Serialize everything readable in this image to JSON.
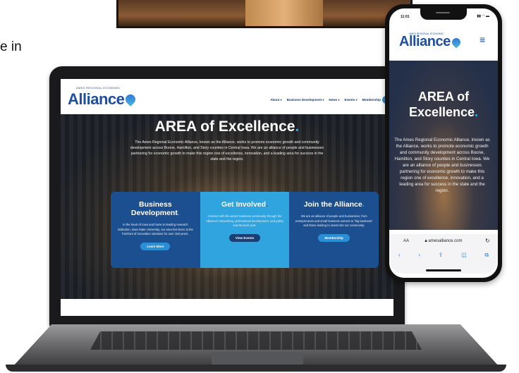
{
  "background": {
    "caption": "e in"
  },
  "laptop_site": {
    "logo": {
      "tagline": "AMES REGIONAL ECONOMIC",
      "word": "Alliance"
    },
    "nav": [
      {
        "label": "About"
      },
      {
        "label": "Business Development"
      },
      {
        "label": "News"
      },
      {
        "label": "Events"
      },
      {
        "label": "Membership"
      }
    ],
    "hero": {
      "title": "AREA of Excellence",
      "title_dot": ".",
      "body": "The Ames Regional Economic Alliance, known as the Alliance, works to promote economic growth and community development across Boone, Hamilton, and Story counties in Central Iowa. We are an alliance of people and businesses partnering for economic growth to make this region one of excellence, innovation, and a leading area for success in the state and the region."
    },
    "cards": [
      {
        "title": "Business Development",
        "body": "In the heart of Iowa and home to leading research institution, Iowa State University, our area has been at the forefront of innovation solutions for over 150 years.",
        "button": "Learn More"
      },
      {
        "title": "Get Involved",
        "body": "Connect with the area's business community through the Alliance's networking, professional development, and policy events each year.",
        "button": "View Events"
      },
      {
        "title": "Join the Alliance",
        "body": "We are an alliance of people and businesses, from entrepreneurs and small business owners to \"big business\" and those looking to invest into our community.",
        "button": "Membership"
      }
    ]
  },
  "phone_site": {
    "time": "11:01",
    "logo": {
      "tagline": "AMES REGIONAL ECONOMIC",
      "word": "Alliance"
    },
    "hero": {
      "title_line1": "AREA of",
      "title_line2": "Excellence",
      "title_dot": ".",
      "body": "The Ames Regional Economic Alliance, known as the Alliance, works to promote economic growth and community development across Boone, Hamilton, and Story counties in Central Iowa. We are an alliance of people and businesses partnering for economic growth to make this region one of excellence, innovation, and a leading area for success in the state and the region."
    },
    "browser": {
      "aa": "AA",
      "url": "amesalliance.com"
    }
  }
}
